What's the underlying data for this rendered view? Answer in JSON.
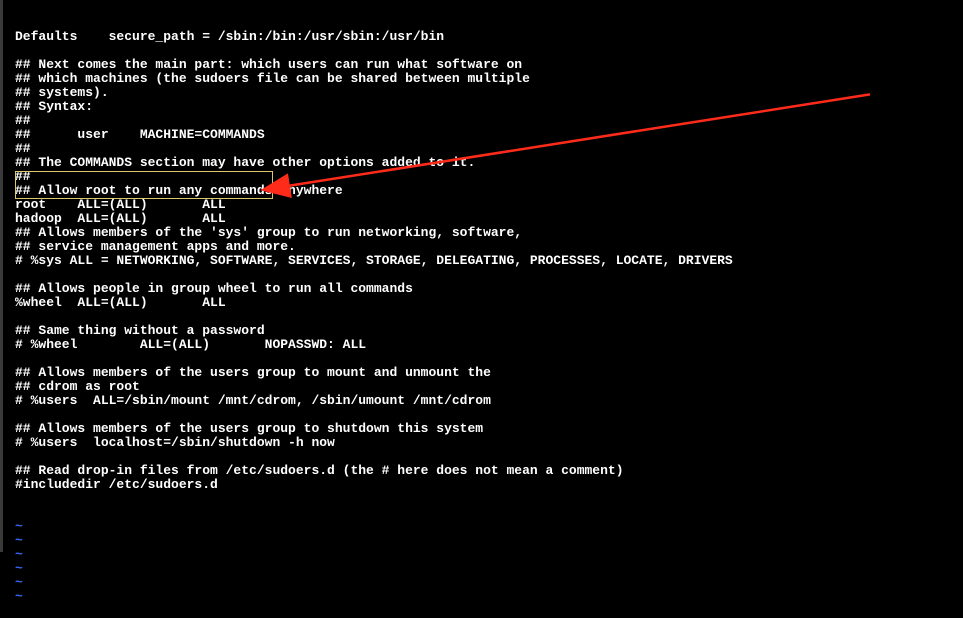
{
  "file": {
    "lines": [
      "Defaults    secure_path = /sbin:/bin:/usr/sbin:/usr/bin",
      "",
      "## Next comes the main part: which users can run what software on",
      "## which machines (the sudoers file can be shared between multiple",
      "## systems).",
      "## Syntax:",
      "##",
      "##      user    MACHINE=COMMANDS",
      "##",
      "## The COMMANDS section may have other options added to it.",
      "##",
      "## Allow root to run any commands anywhere",
      "root    ALL=(ALL)       ALL",
      "hadoop  ALL=(ALL)       ALL",
      "## Allows members of the 'sys' group to run networking, software,",
      "## service management apps and more.",
      "# %sys ALL = NETWORKING, SOFTWARE, SERVICES, STORAGE, DELEGATING, PROCESSES, LOCATE, DRIVERS",
      "",
      "## Allows people in group wheel to run all commands",
      "%wheel  ALL=(ALL)       ALL",
      "",
      "## Same thing without a password",
      "# %wheel        ALL=(ALL)       NOPASSWD: ALL",
      "",
      "## Allows members of the users group to mount and unmount the",
      "## cdrom as root",
      "# %users  ALL=/sbin/mount /mnt/cdrom, /sbin/umount /mnt/cdrom",
      "",
      "## Allows members of the users group to shutdown this system",
      "# %users  localhost=/sbin/shutdown -h now",
      "",
      "## Read drop-in files from /etc/sudoers.d (the # here does not mean a comment)",
      "#includedir /etc/sudoers.d"
    ]
  },
  "tilde_count": 6,
  "tilde_char": "~",
  "annotation": {
    "highlight_lines": [
      12,
      13
    ],
    "arrow_color": "#ff2b1a"
  }
}
